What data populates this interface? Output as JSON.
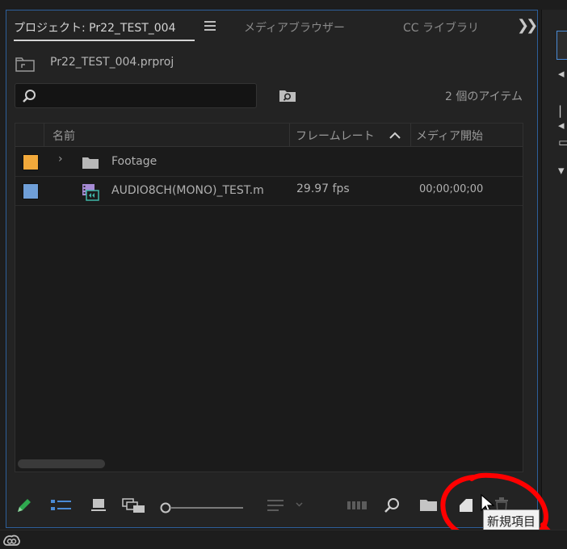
{
  "tabs": [
    {
      "label": "プロジェクト: Pr22_TEST_004",
      "active": true
    },
    {
      "label": "メディアブラウザー",
      "active": false
    },
    {
      "label": "CC ライブラリ",
      "active": false
    }
  ],
  "project": {
    "file_name": "Pr22_TEST_004.prproj"
  },
  "search": {
    "value": "",
    "placeholder": ""
  },
  "item_count": "2 個のアイテム",
  "columns": {
    "name": "名前",
    "frame_rate": "フレームレート",
    "media_start": "メディア開始"
  },
  "items": [
    {
      "type": "bin",
      "label_color": "#f2a93b",
      "name": "Footage",
      "frame_rate": "",
      "media_start": ""
    },
    {
      "type": "clip",
      "label_color": "#6f9fd8",
      "name": "AUDIO8CH(MONO)_TEST.m",
      "frame_rate": "29.97 fps",
      "media_start": "00;00;00;00"
    }
  ],
  "tooltip": "新規項目",
  "colors": {
    "accent": "#2d5f9a",
    "annotation": "#ff0000",
    "pencil": "#2fa84f",
    "list_view": "#4a8bd6"
  },
  "icons": [
    "pencil-icon",
    "list-view-icon",
    "icon-view-icon",
    "freeform-view-icon",
    "zoom-slider",
    "sort-icons-icon",
    "automate-to-sequence-icon",
    "find-icon",
    "new-bin-icon",
    "new-item-icon",
    "trash-icon"
  ]
}
